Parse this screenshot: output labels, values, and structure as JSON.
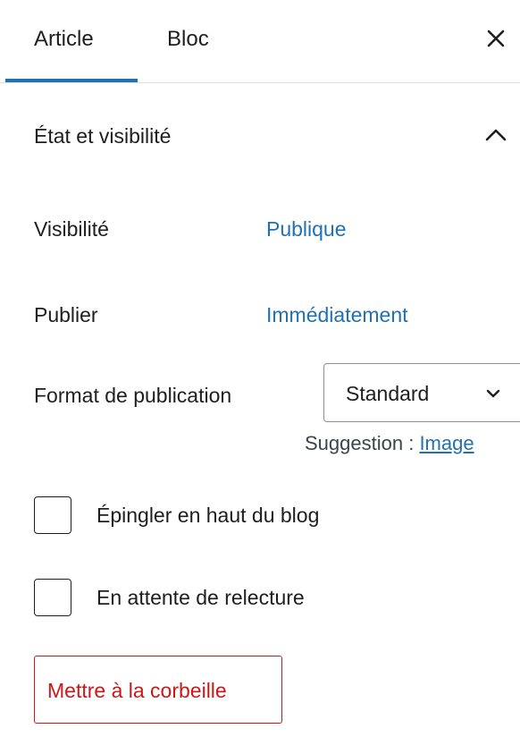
{
  "tabs": [
    {
      "label": "Article",
      "active": true
    },
    {
      "label": "Bloc",
      "active": false
    }
  ],
  "close_icon": "close-icon",
  "panel": {
    "title": "État et visibilité",
    "expanded": true,
    "toggle_icon": "chevron-up-icon"
  },
  "visibility": {
    "label": "Visibilité",
    "value": "Publique"
  },
  "publish": {
    "label": "Publier",
    "value": "Immédiatement"
  },
  "format": {
    "label": "Format de publication",
    "selected": "Standard",
    "suggestion_prefix": "Suggestion : ",
    "suggestion_link": "Image"
  },
  "options": [
    {
      "label": "Épingler en haut du blog",
      "checked": false
    },
    {
      "label": "En attente de relecture",
      "checked": false
    }
  ],
  "trash": {
    "label": "Mettre à la corbeille"
  },
  "colors": {
    "accent": "#2271b1",
    "danger": "#cc1818",
    "text": "#1e1e1e"
  }
}
